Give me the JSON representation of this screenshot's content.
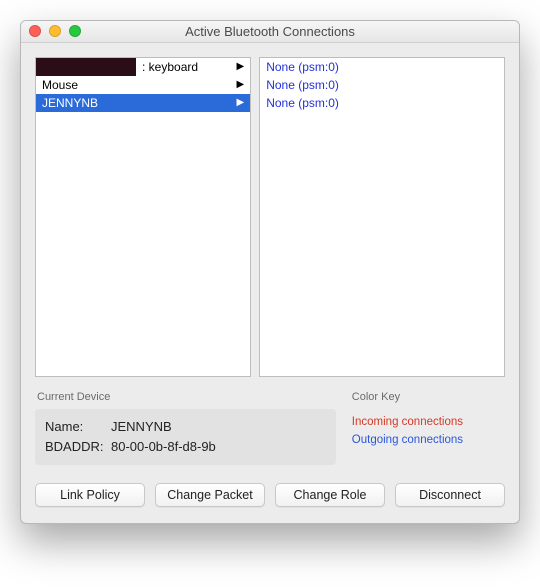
{
  "window": {
    "title": "Active Bluetooth Connections"
  },
  "devices": [
    {
      "label": ": keyboard",
      "redacted": true,
      "selected": false
    },
    {
      "label": "Mouse",
      "redacted": false,
      "selected": false
    },
    {
      "label": "JENNYNB",
      "redacted": false,
      "selected": true
    }
  ],
  "connections": [
    {
      "label": "None (psm:0)"
    },
    {
      "label": "None (psm:0)"
    },
    {
      "label": "None (psm:0)"
    }
  ],
  "current_device": {
    "group_title": "Current Device",
    "name_label": "Name:",
    "name_value": "JENNYNB",
    "bdaddr_label": "BDADDR:",
    "bdaddr_value": "80-00-0b-8f-d8-9b"
  },
  "color_key": {
    "group_title": "Color Key",
    "incoming": "Incoming connections",
    "outgoing": "Outgoing connections"
  },
  "buttons": {
    "link_policy": "Link Policy",
    "change_packet": "Change Packet",
    "change_role": "Change Role",
    "disconnect": "Disconnect"
  }
}
